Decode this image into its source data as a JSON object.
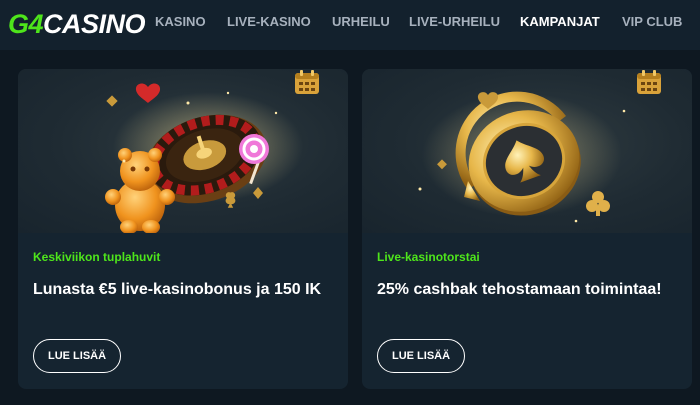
{
  "brand": {
    "logo_g4": "G4",
    "logo_text": "CASINO",
    "accent": "#4ee51b"
  },
  "nav": {
    "items": [
      {
        "label": "KASINO",
        "active": false
      },
      {
        "label": "LIVE-KASINO",
        "active": false
      },
      {
        "label": "URHEILU",
        "active": false
      },
      {
        "label": "LIVE-URHEILU",
        "active": false
      },
      {
        "label": "KAMPANJAT",
        "active": true
      },
      {
        "label": "VIP CLUB",
        "active": false
      }
    ]
  },
  "cards": [
    {
      "kicker": "Keskiviikon tuplahuvit",
      "title": "Lunasta €5 live-kasinobonus ja 150 IK",
      "button": "LUE LISÄÄ",
      "hero_icon": "roulette-wheel-gummy-bear-candy"
    },
    {
      "kicker": "Live-kasinotorstai",
      "title": "25% cashbak tehostamaan toimintaa!",
      "button": "LUE LISÄÄ",
      "hero_icon": "gold-spade-chip-with-arrow"
    }
  ],
  "colors": {
    "background": "#0e1821",
    "topbar": "#13212d",
    "card": "#152430",
    "nav_text": "#a7b1bd"
  }
}
